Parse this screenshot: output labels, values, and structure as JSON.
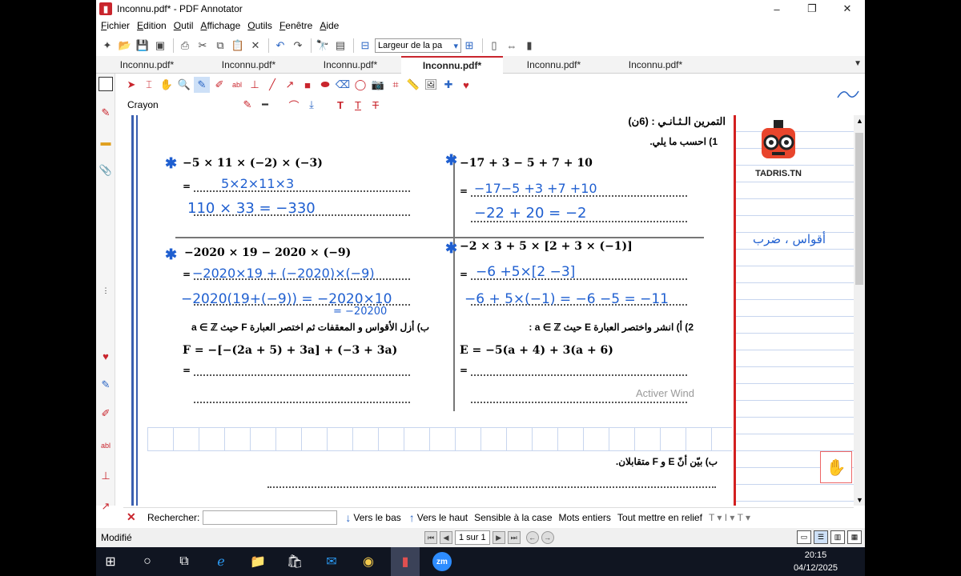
{
  "window": {
    "title": "Inconnu.pdf* - PDF Annotator"
  },
  "menu": {
    "items": [
      {
        "first": "F",
        "rest": "ichier"
      },
      {
        "first": "E",
        "rest": "dition"
      },
      {
        "first": "O",
        "rest": "util"
      },
      {
        "first": "A",
        "rest": "ffichage"
      },
      {
        "first": "O",
        "rest": "utils"
      },
      {
        "first": "F",
        "rest": "enêtre"
      },
      {
        "first": "A",
        "rest": "ide"
      }
    ]
  },
  "toolbar": {
    "zoom_value": "Largeur de la pa"
  },
  "tabs": [
    "Inconnu.pdf*",
    "Inconnu.pdf*",
    "Inconnu.pdf*",
    "Inconnu.pdf*",
    "Inconnu.pdf*",
    "Inconnu.pdf*"
  ],
  "active_tab": 3,
  "annotation": {
    "tool_label": "Crayon"
  },
  "document": {
    "exercise_title": "التمرين الـثـانـي : (6ن)",
    "q1": "1)  احسب ما يلي.",
    "expr1": "−5 × 11 × (−2) × (−3)",
    "expr2": "−17 + 3 − 5 + 7 + 10",
    "expr3": "−2020 × 19 − 2020 × (−9)",
    "expr4": "−2 × 3 + 5 × [2 + 3 × (−1)]",
    "hand1a": "5×2×11×3",
    "hand1b": "110 × 33 = −330",
    "hand2a": "−17−5 +3 +7 +10",
    "hand2b": "−22 + 20 = −2",
    "hand3a": "−2020×19 + (−2020)×(−9)",
    "hand3b": "−2020(19+(−9)) = −2020×10",
    "hand3c": "= −20200",
    "hand4a": "−6 +5×[2 −3]",
    "hand4b": "−6 + 5×(−1) = −6 −5 = −11",
    "q2a": "2)  أ) انشر واختصر العبارة E حيث  a ∈ ℤ :",
    "q2b": "ب) أزل الأقواس و المعقفات  ثم اختصر العبارة  F  حيث  a ∈ ℤ",
    "exprE": "E = −5(a + 4) + 3(a + 6)",
    "exprF": "F = −[−(2a + 5) + 3a] + (−3 + 3a)",
    "eq_sign": "=",
    "margin_note": "أقواس ، ضرب",
    "b_question": "ب) بيّن أنّ  E  و  F  متقابلان.",
    "logo_text": "TADRIS.TN",
    "watermark": "Activer Wind"
  },
  "search": {
    "label": "Rechercher:",
    "value": "",
    "down_label": "Vers le bas",
    "up_label": "Vers le haut",
    "opt_case": "Sensible à la case",
    "opt_words": "Mots entiers",
    "opt_highlight": "Tout mettre en relief"
  },
  "status": {
    "text": "Modifié",
    "page": "1 sur 1"
  },
  "taskbar": {
    "time": "20:15",
    "date": "04/12/2025"
  },
  "colors": {
    "accent": "#c9252d",
    "ink_blue": "#1f5fd0",
    "margin_red": "#d32020"
  },
  "icons": [
    "app-icon",
    "new-icon",
    "open-icon",
    "save-icon",
    "print-icon",
    "cut-icon",
    "copy-icon",
    "undo-icon",
    "redo-icon",
    "pen-icon",
    "highlighter-icon",
    "eraser-icon",
    "camera-icon",
    "heart-icon",
    "search-icon",
    "close-icon"
  ]
}
